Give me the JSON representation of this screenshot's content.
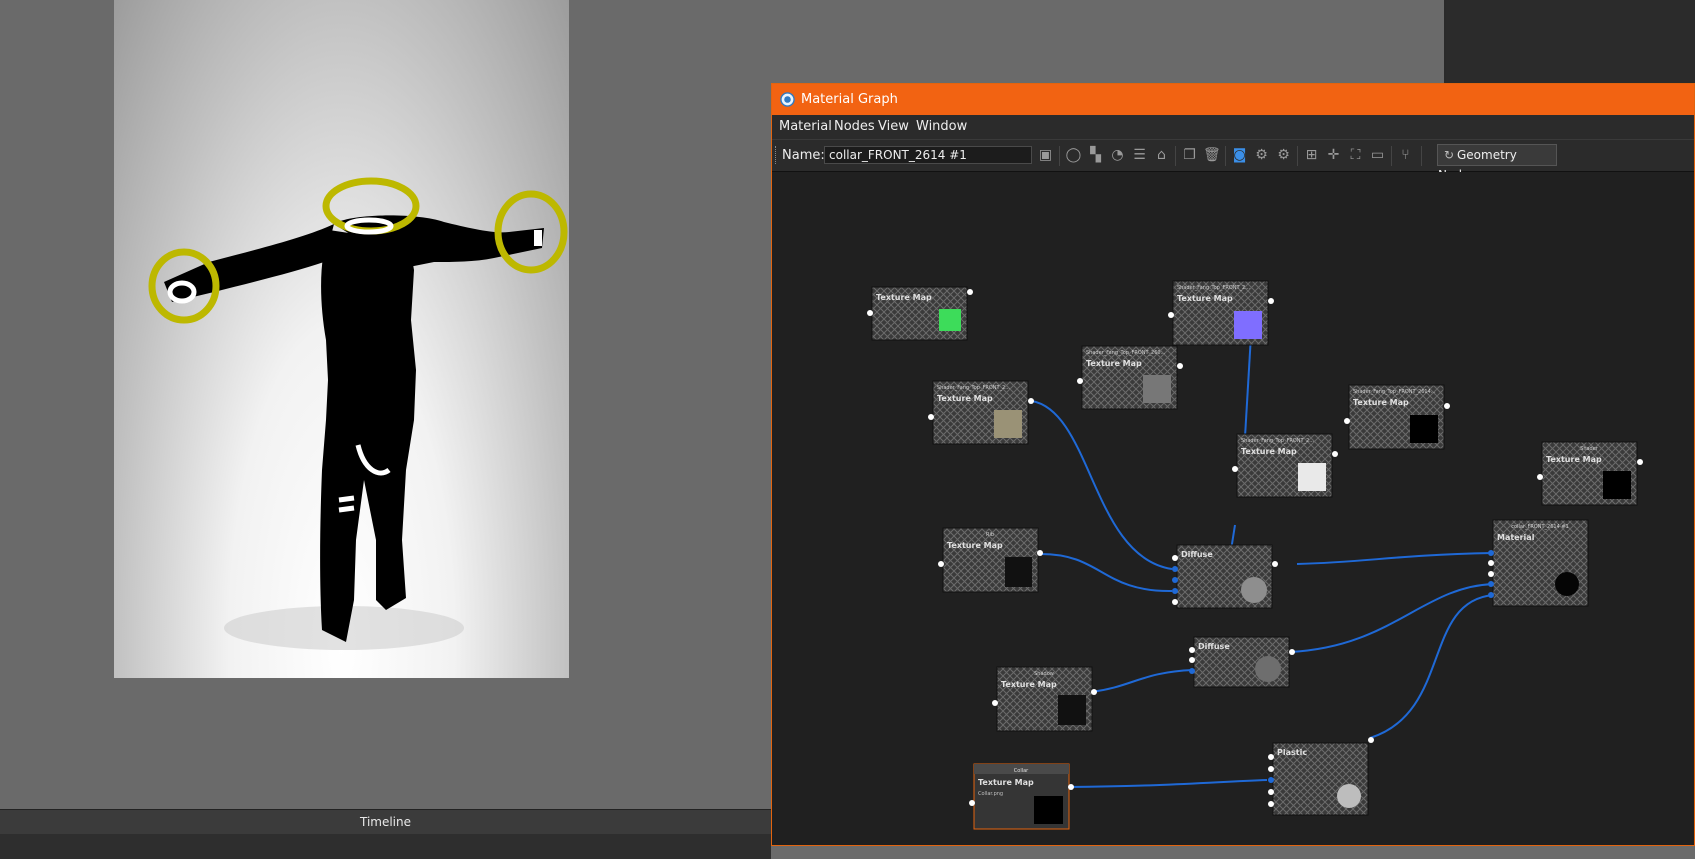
{
  "timeline": {
    "label": "Timeline"
  },
  "material_graph": {
    "title": "Material Graph",
    "menu": [
      "Material",
      "Nodes",
      "View",
      "Window"
    ],
    "toolbar": {
      "name_label": "Name:",
      "name_value": "collar_FRONT_2614 #1",
      "geometry_nodes_label": "Geometry Nodes",
      "icons": [
        "save-icon",
        "sphere-preview-icon",
        "checker-icon",
        "refresh-icon",
        "settings-sliders-icon",
        "bucket-icon",
        "copy-icon",
        "trash-icon",
        "link-icon",
        "node-add-icon",
        "node-remove-icon",
        "align-icon",
        "snap-icon",
        "fit-icon",
        "zoom-100-icon",
        "branch-icon"
      ]
    },
    "nodes": {
      "n1": {
        "header": "",
        "type": "Texture Map"
      },
      "n2": {
        "header": "Shader_Fang_Top_FRONT_2...",
        "type": "Texture Map"
      },
      "n3": {
        "header": "Shader_Fang_Top_FRONT_260...",
        "type": "Texture Map"
      },
      "n4": {
        "header": "Shader_Fang_Top_FRONT_2...",
        "type": "Texture Map"
      },
      "n5": {
        "header": "Shader_Fang_Top_FRONT_2...",
        "type": "Texture Map"
      },
      "n6": {
        "header": "Shader_Fang_Top_FRONT_2614...",
        "type": "Texture Map"
      },
      "n7": {
        "header": "Shader",
        "type": "Texture Map"
      },
      "n8": {
        "header": "Rib",
        "type": "Texture Map"
      },
      "n9": {
        "header": "",
        "type": "Diffuse"
      },
      "n10": {
        "header": "collar_FRONT_2614 #1",
        "type": "Material"
      },
      "n11": {
        "header": "",
        "type": "Diffuse"
      },
      "n12": {
        "header": "Shadow",
        "type": "Texture Map"
      },
      "n13": {
        "header": "",
        "type": "Plastic"
      },
      "n14": {
        "header": "Collar",
        "type": "Texture Map",
        "sub": "Collar.png"
      }
    }
  }
}
